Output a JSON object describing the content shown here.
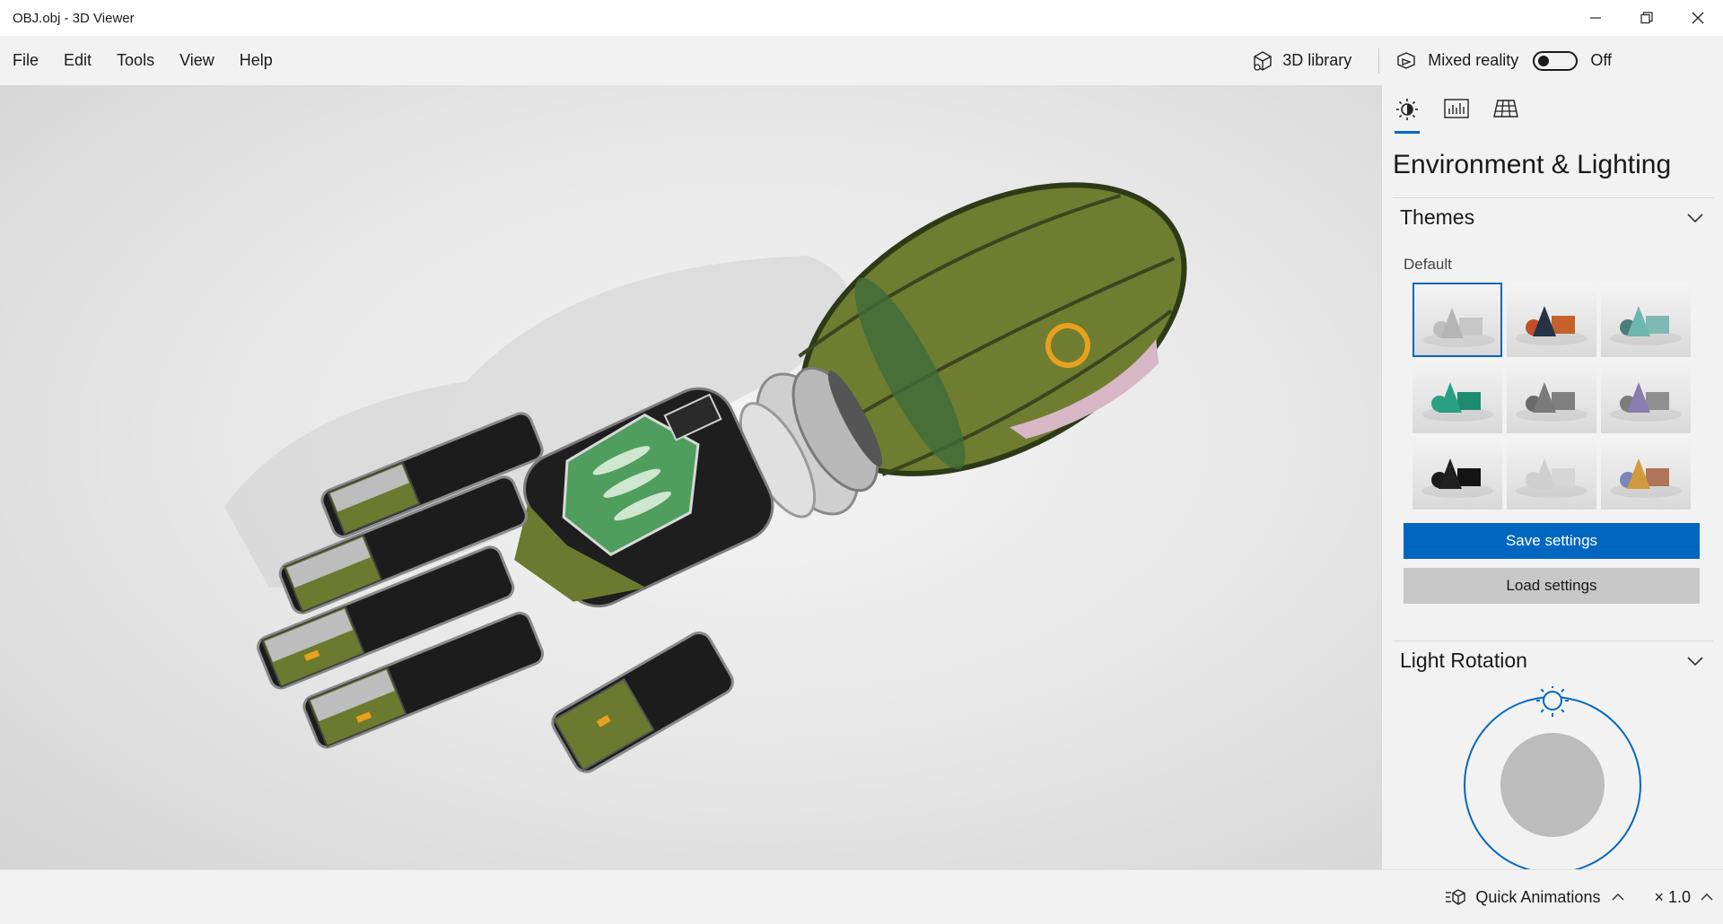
{
  "window": {
    "title": "OBJ.obj - 3D Viewer",
    "controls": [
      "minimize",
      "restore",
      "close"
    ]
  },
  "menu": {
    "items": [
      "File",
      "Edit",
      "Tools",
      "View",
      "Help"
    ],
    "library_label": "3D library",
    "mixed_reality_label": "Mixed reality",
    "mixed_reality_state": "Off"
  },
  "panel": {
    "tabs": [
      "environment-lighting-tab",
      "stats-tab",
      "grid-tab"
    ],
    "title": "Environment & Lighting",
    "themes_section": {
      "label": "Themes",
      "current": "Default",
      "theme_colors": [
        {
          "cone": "#b5b5b5",
          "sphere": "#bdbdbd",
          "box": "#c7c7c7"
        },
        {
          "cone": "#263246",
          "sphere": "#c0502a",
          "box": "#c4622a"
        },
        {
          "cone": "#6fb6b0",
          "sphere": "#4d7d7a",
          "box": "#7fb9b2"
        },
        {
          "cone": "#2aa083",
          "sphere": "#2aa083",
          "box": "#1e8b71"
        },
        {
          "cone": "#7a7a7a",
          "sphere": "#6b6b6b",
          "box": "#808080"
        },
        {
          "cone": "#8a7db0",
          "sphere": "#7c7c7c",
          "box": "#8f8f8f"
        },
        {
          "cone": "#1f1f1f",
          "sphere": "#1b1b1b",
          "box": "#141414"
        },
        {
          "cone": "#cfcfcf",
          "sphere": "#cfcfcf",
          "box": "#d6d6d6"
        },
        {
          "cone": "#d29a3d",
          "sphere": "#7b87b8",
          "box": "#b07456"
        }
      ]
    },
    "save_label": "Save settings",
    "load_label": "Load settings",
    "light_section": {
      "label": "Light Rotation"
    }
  },
  "status": {
    "quick_animations_label": "Quick Animations",
    "speed_label": "× 1.0"
  },
  "colors": {
    "accent": "#0067c0",
    "model_armor": "#6b7a2e",
    "model_dark": "#1c1c1c",
    "model_panel": "#4f9e5e"
  }
}
